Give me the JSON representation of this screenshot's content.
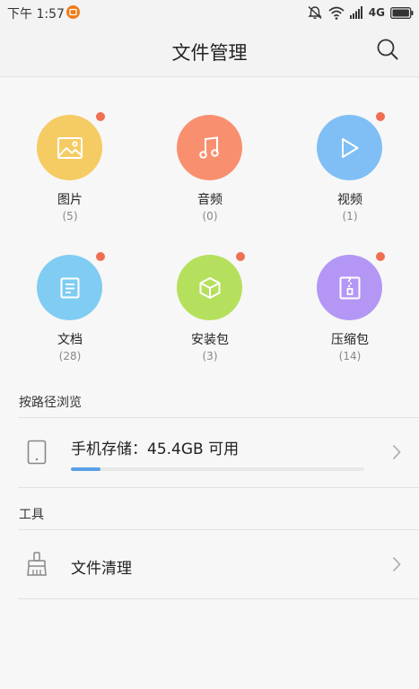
{
  "status_bar": {
    "time": "下午 1:57",
    "network": "4G",
    "notification_icon": "app-notification-icon",
    "icons": [
      "mute-icon",
      "wifi-icon",
      "signal-icon",
      "battery-icon"
    ]
  },
  "header": {
    "title": "文件管理",
    "search_icon": "search-icon"
  },
  "categories": [
    {
      "label": "图片",
      "count": "(5)",
      "color": "#f5cb63",
      "icon": "image-icon",
      "badge": true
    },
    {
      "label": "音频",
      "count": "(0)",
      "color": "#f89070",
      "icon": "music-icon",
      "badge": false
    },
    {
      "label": "视频",
      "count": "(1)",
      "color": "#80bff5",
      "icon": "play-icon",
      "badge": true
    },
    {
      "label": "文档",
      "count": "(28)",
      "color": "#80ccf2",
      "icon": "document-icon",
      "badge": true
    },
    {
      "label": "安装包",
      "count": "(3)",
      "color": "#b5e05d",
      "icon": "package-icon",
      "badge": true
    },
    {
      "label": "压缩包",
      "count": "(14)",
      "color": "#b497f5",
      "icon": "zip-icon",
      "badge": true
    }
  ],
  "browse_section": {
    "title": "按路径浏览",
    "storage_label": "手机存储：45.4GB 可用",
    "storage_progress": 0.1,
    "storage_icon": "phone-icon"
  },
  "tools_section": {
    "title": "工具",
    "cleanup_label": "文件清理",
    "cleanup_icon": "broom-icon"
  }
}
